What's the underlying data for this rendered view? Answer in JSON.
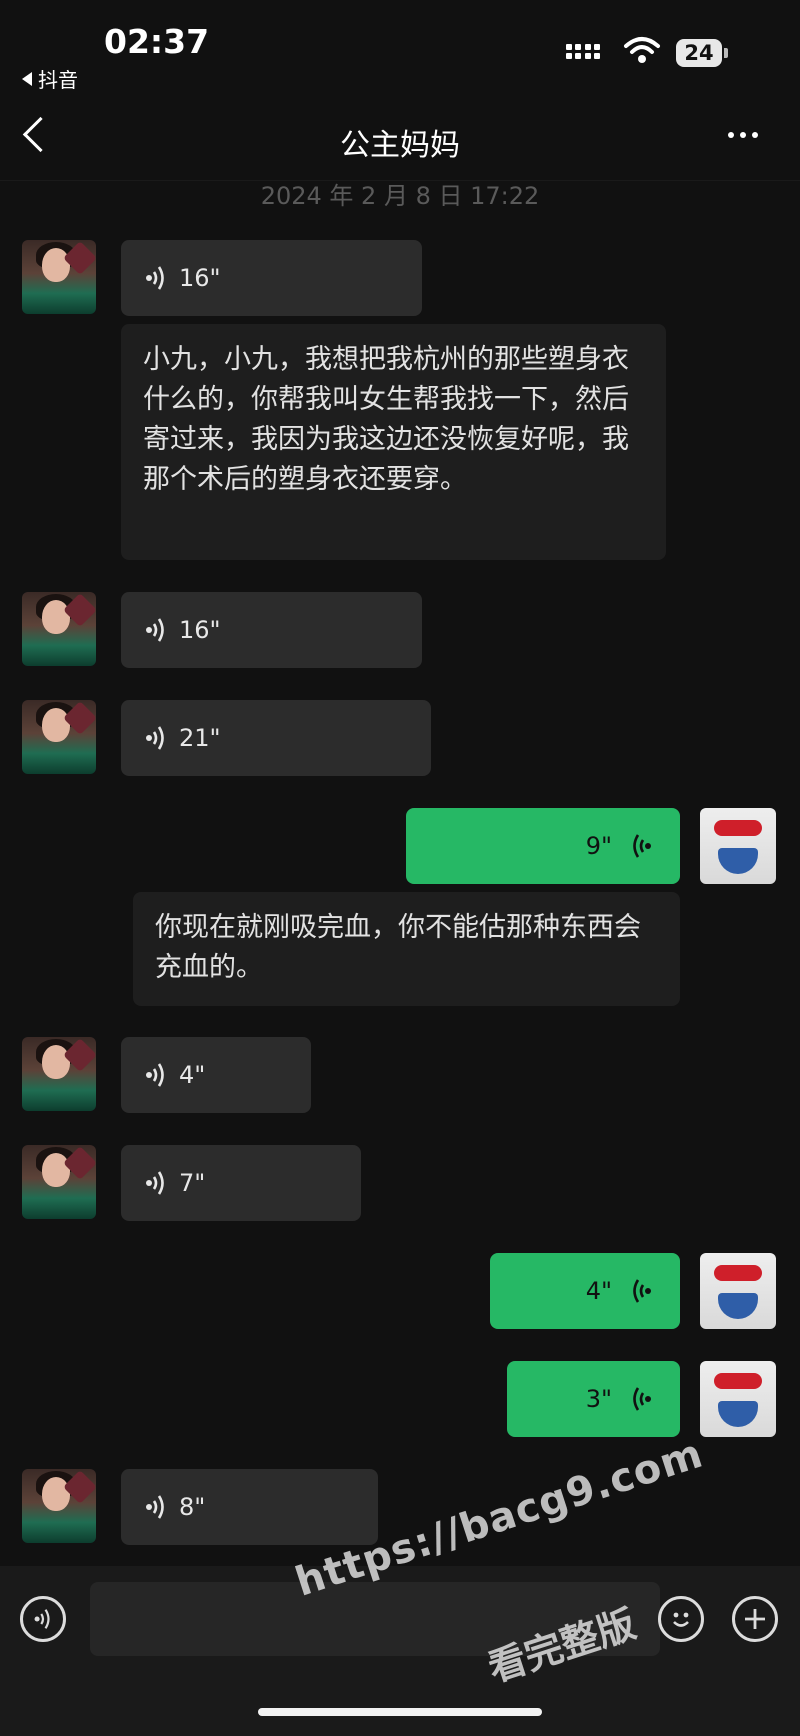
{
  "status_bar": {
    "time": "02:37",
    "back_app": "抖音",
    "battery": "24"
  },
  "header": {
    "title": "公主妈妈"
  },
  "timestamp": "2024 年 2 月 8 日 17:22",
  "messages": [
    {
      "side": "in",
      "type": "voice",
      "duration": "16\""
    },
    {
      "side": "in",
      "type": "transcript",
      "text": "小九，小九，我想把我杭州的那些塑身衣什么的，你帮我叫女生帮我找一下，然后寄过来，我因为我这边还没恢复好呢，我那个术后的塑身衣还要穿。"
    },
    {
      "side": "in",
      "type": "voice",
      "duration": "16\""
    },
    {
      "side": "in",
      "type": "voice",
      "duration": "21\""
    },
    {
      "side": "out",
      "type": "voice",
      "duration": "9\""
    },
    {
      "side": "out",
      "type": "transcript",
      "text": "你现在就刚吸完血，你不能估那种东西会充血的。"
    },
    {
      "side": "in",
      "type": "voice",
      "duration": "4\""
    },
    {
      "side": "in",
      "type": "voice",
      "duration": "7\""
    },
    {
      "side": "out",
      "type": "voice",
      "duration": "4\""
    },
    {
      "side": "out",
      "type": "voice",
      "duration": "3\""
    },
    {
      "side": "in",
      "type": "voice",
      "duration": "8\""
    }
  ],
  "watermark": {
    "line1": "https://bacg9.com",
    "line2": "看完整版"
  },
  "colors": {
    "background": "#111111",
    "bubble_in": "#2c2c2c",
    "bubble_out": "#26b865",
    "transcript_bg": "#1e1e1e"
  },
  "icons": [
    "back-icon",
    "more-icon",
    "voice-wave-icon",
    "voice-mode-icon",
    "emoji-icon",
    "plus-icon",
    "signal-icon",
    "wifi-icon"
  ]
}
